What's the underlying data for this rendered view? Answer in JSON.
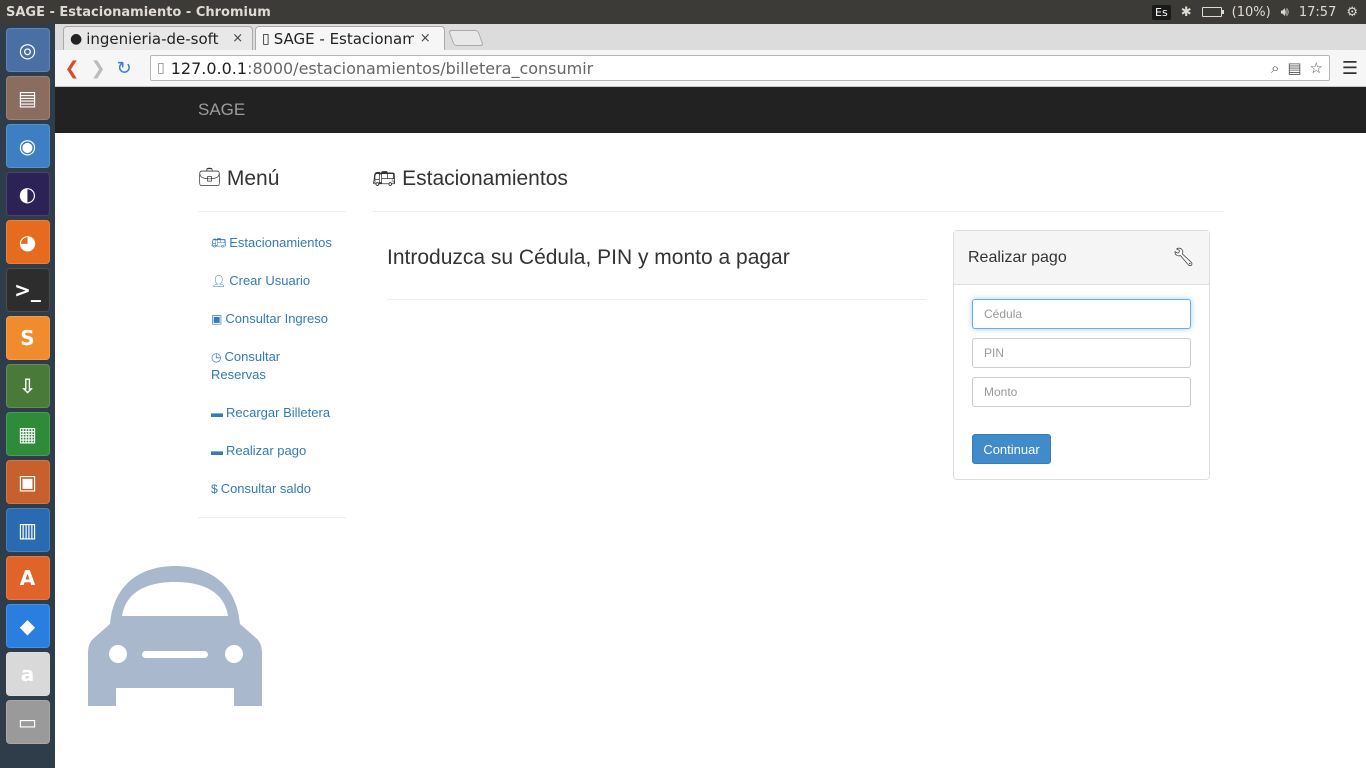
{
  "os_panel": {
    "window_title": "SAGE - Estacionamiento - Chromium",
    "keyboard_layout": "Es",
    "battery": "(10%)",
    "time": "17:57"
  },
  "launcher": {
    "items": [
      {
        "name": "ubuntu-dash-icon",
        "glyph": "◎",
        "color": "#4a6fa5"
      },
      {
        "name": "files-icon",
        "glyph": "▤",
        "color": "#8a6d5e"
      },
      {
        "name": "chromium-icon",
        "glyph": "◉",
        "color": "#3d7fc2"
      },
      {
        "name": "eclipse-icon",
        "glyph": "◐",
        "color": "#2c2255"
      },
      {
        "name": "firefox-icon",
        "glyph": "◕",
        "color": "#e66b1f"
      },
      {
        "name": "terminal-icon",
        "glyph": ">_",
        "color": "#2d2d2d"
      },
      {
        "name": "sublime-text-icon",
        "glyph": "S",
        "color": "#f08b2e"
      },
      {
        "name": "install-icon",
        "glyph": "⇩",
        "color": "#4a7a3a"
      },
      {
        "name": "calc-icon",
        "glyph": "▦",
        "color": "#2e8b3a"
      },
      {
        "name": "impress-icon",
        "glyph": "▣",
        "color": "#c8602d"
      },
      {
        "name": "writer-icon",
        "glyph": "▥",
        "color": "#2a6ab0"
      },
      {
        "name": "software-center-icon",
        "glyph": "A",
        "color": "#e0642a"
      },
      {
        "name": "dropbox-icon",
        "glyph": "◆",
        "color": "#2a7ee0"
      },
      {
        "name": "amazon-icon",
        "glyph": "a",
        "color": "#d9d9d9"
      },
      {
        "name": "drive-icon",
        "glyph": "▭",
        "color": "#9a9a9a"
      }
    ]
  },
  "browser": {
    "tabs": [
      {
        "label": "ingenieria-de-soft",
        "icon": "github"
      },
      {
        "label": "SAGE - Estacionam",
        "icon": "page"
      }
    ],
    "tab_close": "×",
    "url_host": "127.0.0.1",
    "url_rest": ":8000/estacionamientos/billetera_consumir"
  },
  "navbar": {
    "brand": "SAGE"
  },
  "sidebar": {
    "title": "Menú",
    "items": [
      {
        "label": "Estacionamientos",
        "icon": "bus-icon"
      },
      {
        "label": "Crear Usuario",
        "icon": "user-icon"
      },
      {
        "label": "Consultar Ingreso",
        "icon": "money-icon"
      },
      {
        "label": "Consultar Reservas",
        "icon": "clock-icon"
      },
      {
        "label": "Recargar Billetera",
        "icon": "credit-card-icon"
      },
      {
        "label": "Realizar pago",
        "icon": "credit-card-icon"
      },
      {
        "label": "Consultar saldo",
        "icon": "dollar-icon"
      }
    ]
  },
  "main": {
    "title": "Estacionamientos",
    "subheading": "Introduzca su Cédula, PIN y monto a pagar"
  },
  "payment_panel": {
    "title": "Realizar pago",
    "cedula_placeholder": "Cédula",
    "pin_placeholder": "PIN",
    "monto_placeholder": "Monto",
    "submit_label": "Continuar"
  },
  "colors": {
    "navbar": "#222222",
    "link": "#337ab7",
    "primary": "#428bca",
    "car": "#a9b8cc"
  }
}
